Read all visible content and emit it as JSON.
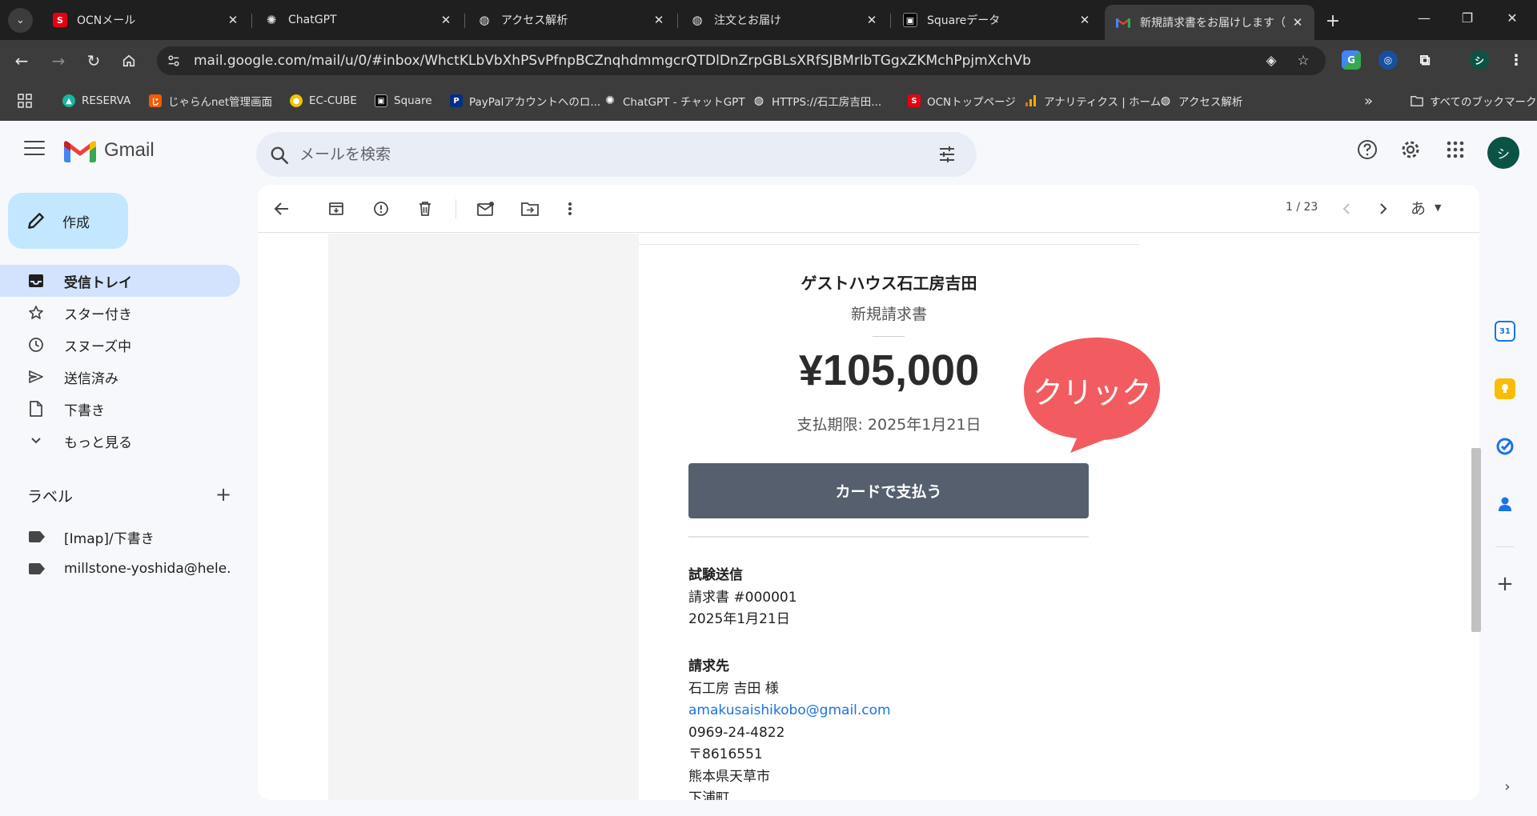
{
  "browser": {
    "tabs": [
      {
        "title": "OCNメール",
        "fav_color": "#e60012",
        "fav_text": "S"
      },
      {
        "title": "ChatGPT",
        "fav_color": "#1f1f1f",
        "fav_text": "✺"
      },
      {
        "title": "アクセス解析",
        "fav_color": "#1f1f1f",
        "fav_text": "◍"
      },
      {
        "title": "注文とお届け",
        "fav_color": "#1f1f1f",
        "fav_text": "◍"
      },
      {
        "title": "Squareデータ",
        "fav_color": "#000000",
        "fav_text": "▣"
      },
      {
        "title": "新規請求書をお届けします（",
        "fav_color": "#ffffff",
        "fav_text": "M"
      }
    ],
    "url": "mail.google.com/mail/u/0/#inbox/WhctKLbVbXhPSvPfnpBCZnqhdmmgcrQTDlDnZrpGBLsXRfSJBMrlbTGgxZKMchPpjmXchVb",
    "bookmarks": [
      {
        "label": "RESERVA",
        "color": "#19b3a7"
      },
      {
        "label": "じゃらんnet管理画面",
        "color": "#f25c05"
      },
      {
        "label": "EC-CUBE",
        "color": "#f2c200"
      },
      {
        "label": "Square",
        "color": "#000000"
      },
      {
        "label": "PayPalアカウントへのロ...",
        "color": "#003087"
      },
      {
        "label": "ChatGPT - チャットGPT",
        "color": "#1f1f1f"
      },
      {
        "label": "HTTPS://石工房吉田...",
        "color": "#5f6368"
      },
      {
        "label": "OCNトップページ",
        "color": "#e60012"
      },
      {
        "label": "アナリティクス | ホーム",
        "color": "#f9ab00"
      },
      {
        "label": "アクセス解析",
        "color": "#5f6368"
      }
    ],
    "more_bookmarks": "»",
    "all_bookmarks": "すべてのブックマーク"
  },
  "gmail": {
    "logo_text": "Gmail",
    "search_placeholder": "メールを検索",
    "compose_label": "作成",
    "nav": [
      {
        "label": "受信トレイ",
        "icon": "inbox-icon",
        "active": true
      },
      {
        "label": "スター付き",
        "icon": "star-icon"
      },
      {
        "label": "スヌーズ中",
        "icon": "clock-icon"
      },
      {
        "label": "送信済み",
        "icon": "send-icon"
      },
      {
        "label": "下書き",
        "icon": "draft-icon"
      },
      {
        "label": "もっと見る",
        "icon": "chevron-down-icon"
      }
    ],
    "labels_heading": "ラベル",
    "labels": [
      {
        "label": "[Imap]/下書き"
      },
      {
        "label": "millstone-yoshida@hele..."
      }
    ],
    "pager": "1 / 23",
    "lang": "あ",
    "avatar_initial": "シ"
  },
  "email": {
    "business_name": "ゲストハウス石工房吉田",
    "document_type": "新規請求書",
    "amount": "¥105,000",
    "due": "支払期限: 2025年1月21日",
    "pay_button": "カードで支払う",
    "callout": "クリック",
    "test_heading": "試験送信",
    "invoice_number": "請求書 #000001",
    "invoice_date": "2025年1月21日",
    "billto_heading": "請求先",
    "billto_name": "石工房 吉田 様",
    "billto_email": "amakusaishikobo@gmail.com",
    "billto_phone": "0969-24-4822",
    "billto_postal": "〒8616551",
    "billto_pref": "熊本県天草市",
    "billto_town": "下浦町"
  },
  "colors": {
    "accent": "#c2e7ff",
    "active_nav": "#d3e3fd",
    "pay_button": "#555f6d",
    "callout": "#f25c60",
    "link": "#1a73e8"
  }
}
